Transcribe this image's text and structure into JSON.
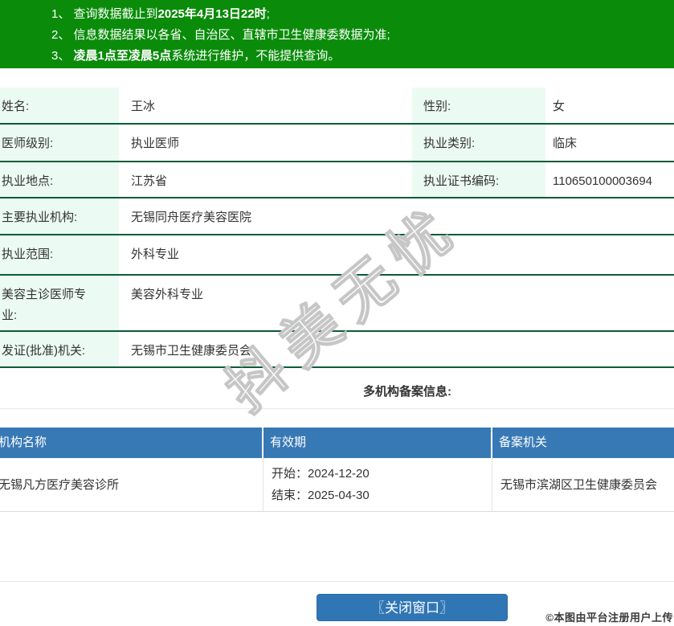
{
  "colors": {
    "banner-green": "#0a8c0a",
    "border-green": "#0b5c36",
    "label-bg": "#ebfaf2",
    "header-blue": "#3779b5",
    "button-blue": "#3076b5",
    "text": "#333333",
    "line-gray": "#e9e9e9"
  },
  "banner": {
    "lines": [
      {
        "pre": "1、 查询数据截止到",
        "bold": "2025年4月13日22时",
        "post": ";"
      },
      {
        "pre": "2、 信息数据结果以各省、自治区、直辖市卫生健康委数据为准;",
        "bold": "",
        "post": ""
      },
      {
        "pre": "3、 ",
        "bold": "凌晨1点至凌晨5点",
        "post": "系统进行维护，不能提供查询。"
      }
    ]
  },
  "profile": {
    "rows": [
      {
        "label": "姓名:",
        "value": "王冰",
        "label2": "性别:",
        "value2": "女"
      },
      {
        "label": "医师级别:",
        "value": "执业医师",
        "label2": "执业类别:",
        "value2": "临床"
      },
      {
        "label": "执业地点:",
        "value": "江苏省",
        "label2": "执业证书编码:",
        "value2": "110650100003694"
      },
      {
        "label": "主要执业机构:",
        "value": "无锡同舟医疗美容医院"
      },
      {
        "label": "执业范围:",
        "value": "外科专业"
      },
      {
        "label": "美容主诊医师专业:",
        "value": "美容外科专业"
      },
      {
        "label": "发证(批准)机关:",
        "value": "无锡市卫生健康委员会"
      }
    ]
  },
  "section": {
    "title": "多机构备案信息:"
  },
  "registrations": {
    "headers": [
      "机构名称",
      "有效期",
      "备案机关"
    ],
    "rows": [
      {
        "org": "无锡凡方医疗美容诊所",
        "start": "开始：2024-12-20",
        "end": "结束：2025-04-30",
        "authority": "无锡市滨湖区卫生健康委员会"
      }
    ]
  },
  "watermark": {
    "text": "抖美无忧"
  },
  "footer": {
    "close_button": "〖关闭窗口〗",
    "copyright": "©本图由平台注册用户上传"
  }
}
